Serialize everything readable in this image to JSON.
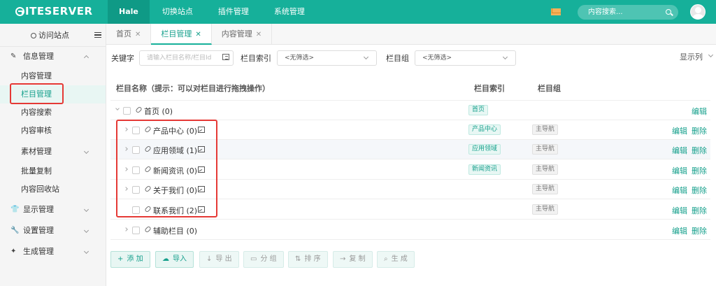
{
  "topbar": {
    "logo": "ITESERVER",
    "nav": [
      {
        "label": "Hale",
        "active": true
      },
      {
        "label": "切换站点",
        "active": false
      },
      {
        "label": "插件管理",
        "active": false
      },
      {
        "label": "系统管理",
        "active": false
      }
    ],
    "search_placeholder": "内容搜索..."
  },
  "sidebar": {
    "visit_site": "访问站点",
    "groups": [
      {
        "label": "信息管理",
        "icon": "edit-icon",
        "expanded": true
      },
      {
        "label": "显示管理",
        "icon": "shirt-icon",
        "expanded": false
      },
      {
        "label": "设置管理",
        "icon": "wrench-icon",
        "expanded": false
      },
      {
        "label": "生成管理",
        "icon": "magic-wand-icon",
        "expanded": false
      }
    ],
    "items": [
      {
        "label": "内容管理"
      },
      {
        "label": "栏目管理",
        "active": true
      },
      {
        "label": "内容搜索"
      },
      {
        "label": "内容审核"
      },
      {
        "label": "素材管理"
      },
      {
        "label": "批量复制"
      },
      {
        "label": "内容回收站"
      }
    ]
  },
  "tabs": [
    {
      "label": "首页",
      "active": false
    },
    {
      "label": "栏目管理",
      "active": true
    },
    {
      "label": "内容管理",
      "active": false
    }
  ],
  "filters": {
    "keyword_label": "关键字",
    "keyword_placeholder": "请输入栏目名称/栏目Id",
    "index_label": "栏目索引",
    "index_value": "<无筛选>",
    "group_label": "栏目组",
    "group_value": "<无筛选>",
    "columns_label": "显示列"
  },
  "table": {
    "headers": {
      "name": "栏目名称（提示：可以对栏目进行拖拽操作）",
      "index": "栏目索引",
      "group": "栏目组"
    },
    "rows": [
      {
        "name": "首页 (0)",
        "index": "首页",
        "group": "",
        "edit": "编辑",
        "delete": ""
      },
      {
        "name": "产品中心 (0)",
        "index": "产品中心",
        "group": "主导航",
        "edit": "编辑",
        "delete": "删除"
      },
      {
        "name": "应用领域 (1)",
        "index": "应用领域",
        "group": "主导航",
        "edit": "编辑",
        "delete": "删除"
      },
      {
        "name": "新闻资讯 (0)",
        "index": "新闻资讯",
        "group": "主导航",
        "edit": "编辑",
        "delete": "删除"
      },
      {
        "name": "关于我们 (0)",
        "index": "",
        "group": "主导航",
        "edit": "编辑",
        "delete": "删除"
      },
      {
        "name": "联系我们 (2)",
        "index": "",
        "group": "主导航",
        "edit": "编辑",
        "delete": "删除"
      },
      {
        "name": "辅助栏目 (0)",
        "index": "",
        "group": "",
        "edit": "编辑",
        "delete": "删除"
      }
    ]
  },
  "toolbar": {
    "add": "添 加",
    "import": "导入",
    "export": "导 出",
    "group": "分 组",
    "sort": "排 序",
    "copy": "复 制",
    "generate": "生 成"
  },
  "colors": {
    "brand": "#16b09a",
    "highlight_box": "#e53935"
  }
}
